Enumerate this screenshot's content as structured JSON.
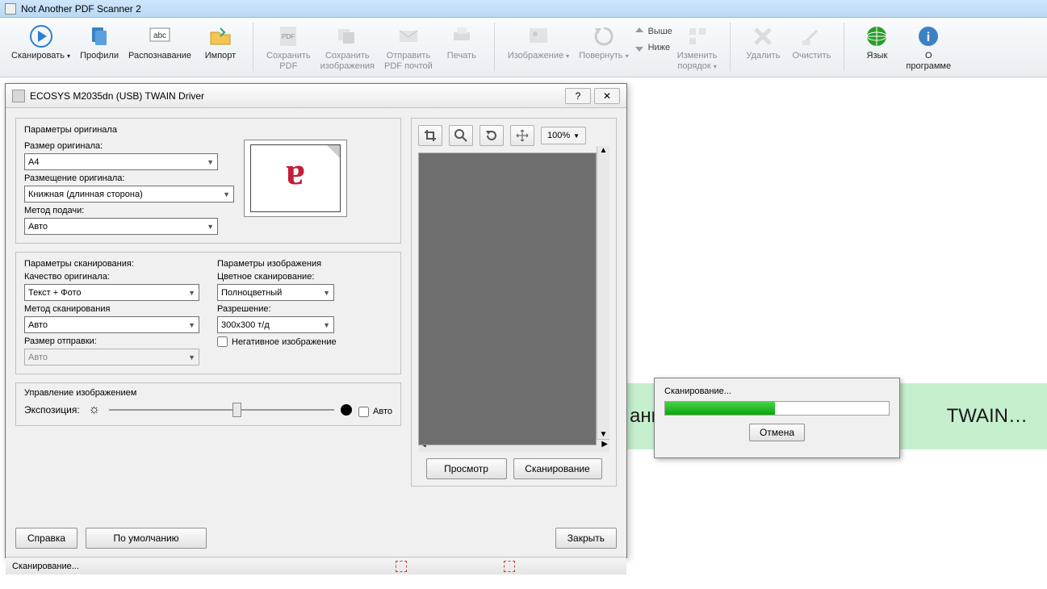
{
  "window": {
    "title": "Not Another PDF Scanner 2"
  },
  "ribbon": {
    "scan": "Сканировать",
    "profiles": "Профили",
    "ocr": "Распознавание",
    "import": "Импорт",
    "savepdf": "Сохранить\nPDF",
    "saveimg": "Сохранить\nизображения",
    "mailpdf": "Отправить\nPDF почтой",
    "print": "Печать",
    "image": "Изображение",
    "rotate": "Повернуть",
    "up": "Выше",
    "down": "Ниже",
    "reorder": "Изменить\nпорядок",
    "delete": "Удалить",
    "clear": "Очистить",
    "language": "Язык",
    "about": "О\nпрограмме"
  },
  "dialog": {
    "title": "ECOSYS M2035dn (USB) TWAIN Driver",
    "orig_header": "Параметры оригинала",
    "size_label": "Размер оригинала:",
    "size_value": "A4",
    "placement_label": "Размещение оригинала:",
    "placement_value": "Книжная (длинная сторона)",
    "feed_label": "Метод подачи:",
    "feed_value": "Авто",
    "scanparam_header": "Параметры сканирования:",
    "quality_label": "Качество оригинала:",
    "quality_value": "Текст + Фото",
    "method_label": "Метод сканирования",
    "method_value": "Авто",
    "sendsize_label": "Размер отправки:",
    "sendsize_value": "Авто",
    "imgparam_header": "Параметры изображения",
    "color_label": "Цветное сканирование:",
    "color_value": "Полноцветный",
    "res_label": "Разрешение:",
    "res_value": "300x300 т/д",
    "negative": "Негативное изображение",
    "imgctrl_header": "Управление изображением",
    "expo": "Экспозиция:",
    "auto": "Авто",
    "help": "Справка",
    "defaults": "По умолчанию",
    "close": "Закрыть",
    "zoom": "100%",
    "preview": "Просмотр",
    "scan": "Сканирование",
    "status": "Сканирование..."
  },
  "progress": {
    "title": "Сканирование...",
    "cancel": "Отмена"
  },
  "strip": {
    "left": "ани",
    "right": "TWAIN…"
  }
}
